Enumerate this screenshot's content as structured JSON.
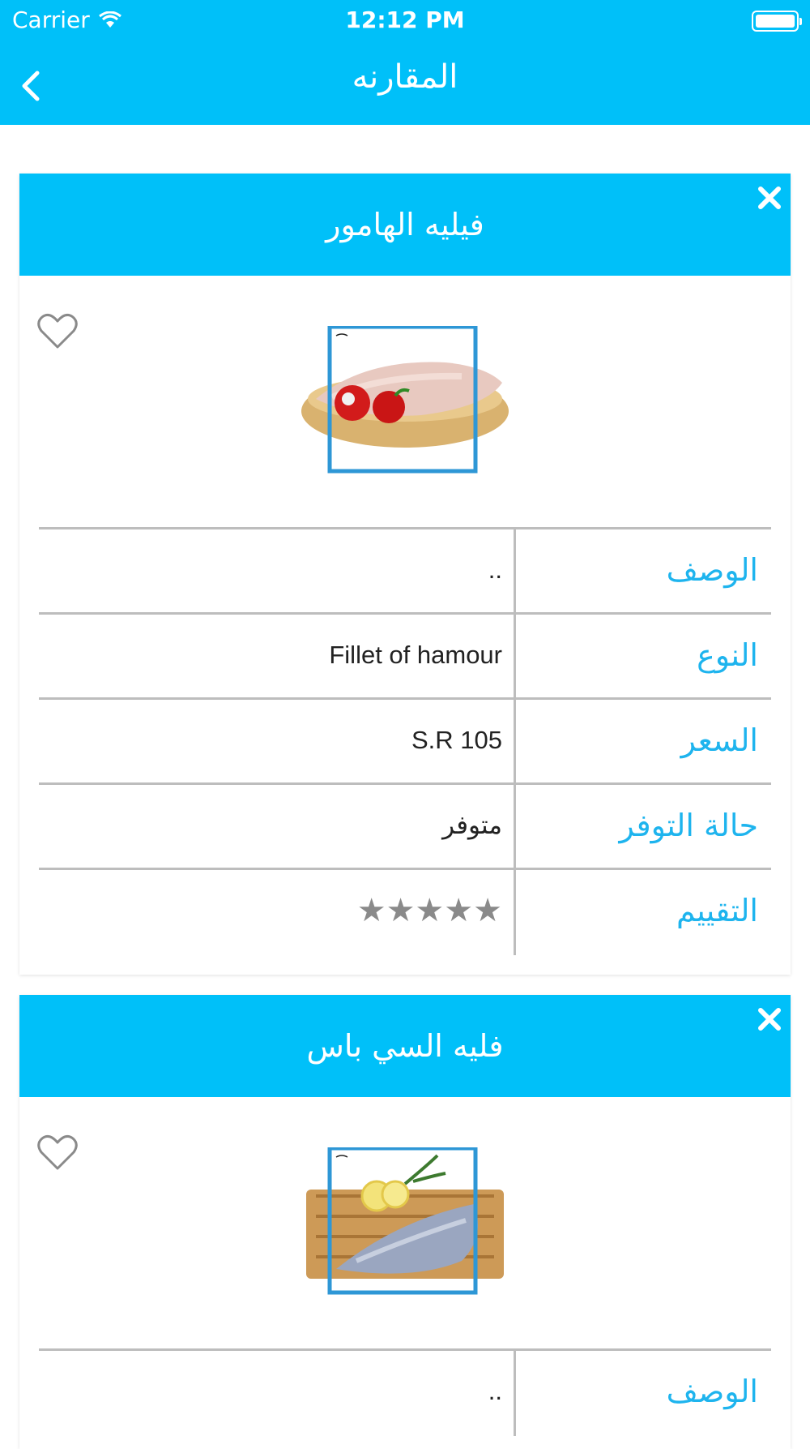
{
  "status": {
    "carrier": "Carrier",
    "time": "12:12 PM"
  },
  "nav": {
    "title": "المقارنه",
    "back_icon": "chevron-left-icon"
  },
  "colors": {
    "brand": "#00c0f9",
    "label": "#1eb4ee",
    "divider": "#bdbdbd",
    "stars": "#8a8a8a"
  },
  "products": [
    {
      "name": "فيليه الهامور",
      "image_name": "hamour-fillet-image",
      "rows": [
        {
          "label": "الوصف",
          "value": ".."
        },
        {
          "label": "النوع",
          "value": "Fillet of hamour"
        },
        {
          "label": "السعر",
          "value": "S.R 105"
        },
        {
          "label": "حالة التوفر",
          "value": "متوفر"
        },
        {
          "label": "التقييم",
          "value": "★★★★★"
        }
      ],
      "rating": 5
    },
    {
      "name": "فليه السي باس",
      "image_name": "seabass-fillet-image",
      "rows": [
        {
          "label": "الوصف",
          "value": ".."
        }
      ]
    }
  ]
}
